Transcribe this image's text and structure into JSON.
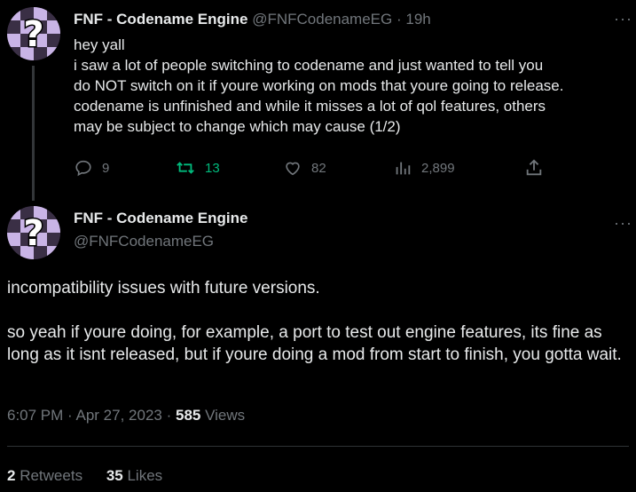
{
  "first_tweet": {
    "author_name": "FNF - Codename Engine",
    "handle": "@FNFCodenameEG",
    "separator": "·",
    "time_ago": "19h",
    "more": "···",
    "lines": [
      "hey yall",
      "i saw a lot of people switching to codename and just wanted to tell you",
      "do NOT switch on it if youre working on mods that youre going to release.",
      "codename is unfinished and while it misses a lot of qol features, others",
      "may be subject to change which may cause (1/2)"
    ],
    "actions": {
      "replies": "9",
      "retweets": "13",
      "likes": "82",
      "views": "2,899"
    },
    "icons": [
      "reply-icon",
      "retweet-icon",
      "like-icon",
      "views-icon",
      "share-icon"
    ],
    "retweet_color": "#00ba7c"
  },
  "second_tweet": {
    "author_name": "FNF - Codename Engine",
    "handle": "@FNFCodenameEG",
    "more": "···",
    "paragraph1": "incompatibility issues with future versions.",
    "paragraph2": "so yeah if youre doing, for example, a port to test out engine features, its fine as long as it isnt released, but if youre doing a mod from start to finish, you gotta wait.",
    "time": "6:07 PM",
    "date": "Apr 27, 2023",
    "views_count": "585",
    "views_label": "Views",
    "retweets_count": "2",
    "retweets_label": "Retweets",
    "likes_count": "35",
    "likes_label": "Likes"
  },
  "colors": {
    "background": "#000000",
    "text": "#e7e9ea",
    "muted": "#71767b"
  }
}
